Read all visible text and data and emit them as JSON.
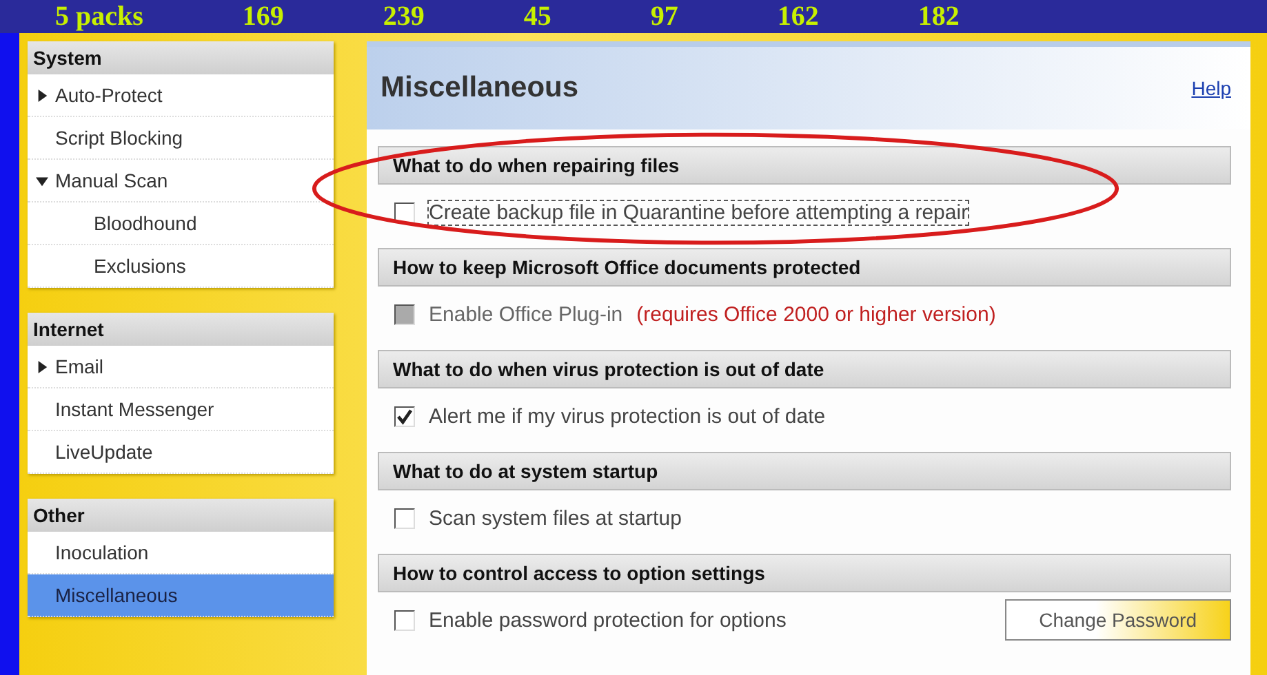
{
  "slide_header": [
    "5 packs",
    "169",
    "239",
    "45",
    "97",
    "162",
    "182"
  ],
  "sidebar": {
    "groups": [
      {
        "title": "System",
        "items": [
          {
            "label": "Auto-Protect",
            "expanded": false,
            "selected": false
          },
          {
            "label": "Script Blocking",
            "selected": false
          },
          {
            "label": "Manual Scan",
            "expanded": true,
            "selected": false,
            "children": [
              {
                "label": "Bloodhound",
                "selected": false
              },
              {
                "label": "Exclusions",
                "selected": false
              }
            ]
          }
        ]
      },
      {
        "title": "Internet",
        "items": [
          {
            "label": "Email",
            "expanded": false,
            "selected": false
          },
          {
            "label": "Instant Messenger",
            "selected": false
          },
          {
            "label": "LiveUpdate",
            "selected": false
          }
        ]
      },
      {
        "title": "Other",
        "items": [
          {
            "label": "Inoculation",
            "selected": false
          },
          {
            "label": "Miscellaneous",
            "selected": true
          }
        ]
      }
    ]
  },
  "panel": {
    "title": "Miscellaneous",
    "help": "Help",
    "sections": [
      {
        "heading": "What to do when repairing files",
        "option": "Create backup file in Quarantine before attempting a repair",
        "checked": false,
        "disabled": false,
        "highlighted": true
      },
      {
        "heading": "How to keep Microsoft Office documents protected",
        "option": "Enable Office Plug-in",
        "note": "(requires Office 2000 or higher version)",
        "disabled": true,
        "highlighted": false
      },
      {
        "heading": "What to do when virus protection is out of date",
        "option": "Alert me if my virus protection is out of date",
        "checked": true,
        "disabled": false,
        "highlighted": false
      },
      {
        "heading": "What to do at system startup",
        "option": "Scan system files at startup",
        "checked": false,
        "disabled": false,
        "highlighted": false
      },
      {
        "heading": "How to control access to option settings",
        "option": "Enable password protection for options",
        "button": "Change Password",
        "checked": false,
        "disabled": false,
        "highlighted": false
      }
    ]
  }
}
